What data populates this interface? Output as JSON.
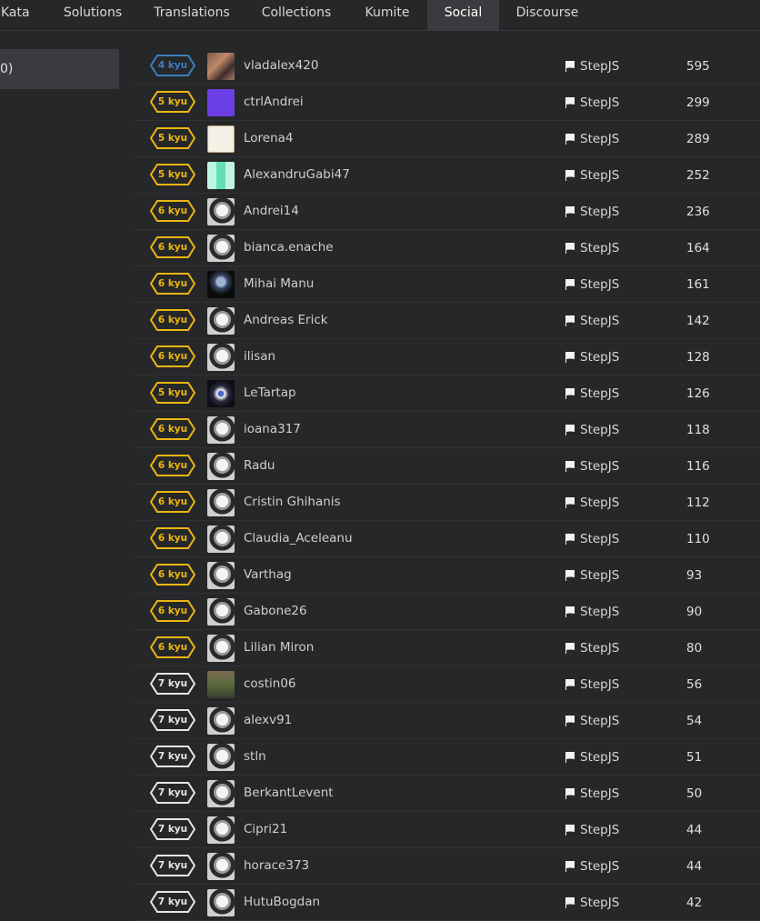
{
  "tabs": [
    {
      "label": "Kata"
    },
    {
      "label": "Solutions"
    },
    {
      "label": "Translations"
    },
    {
      "label": "Collections"
    },
    {
      "label": "Kumite"
    },
    {
      "label": "Social"
    },
    {
      "label": "Discourse"
    }
  ],
  "sidebar": {
    "item_label": "0)"
  },
  "colors": {
    "kyu4": "#3c7ebb",
    "kyu5": "#ecb613",
    "kyu6": "#ecb613",
    "kyu7": "#e6e6e6"
  },
  "members": [
    {
      "rank": "4 kyu",
      "username": "vladalex420",
      "clan": "StepJS",
      "honor": "595"
    },
    {
      "rank": "5 kyu",
      "username": "ctrlAndrei",
      "clan": "StepJS",
      "honor": "299"
    },
    {
      "rank": "5 kyu",
      "username": "Lorena4",
      "clan": "StepJS",
      "honor": "289"
    },
    {
      "rank": "5 kyu",
      "username": "AlexandruGabi47",
      "clan": "StepJS",
      "honor": "252"
    },
    {
      "rank": "6 kyu",
      "username": "Andrei14",
      "clan": "StepJS",
      "honor": "236"
    },
    {
      "rank": "6 kyu",
      "username": "bianca.enache",
      "clan": "StepJS",
      "honor": "164"
    },
    {
      "rank": "6 kyu",
      "username": "Mihai Manu",
      "clan": "StepJS",
      "honor": "161"
    },
    {
      "rank": "6 kyu",
      "username": "Andreas Erick",
      "clan": "StepJS",
      "honor": "142"
    },
    {
      "rank": "6 kyu",
      "username": "ilisan",
      "clan": "StepJS",
      "honor": "128"
    },
    {
      "rank": "5 kyu",
      "username": "LeTartap",
      "clan": "StepJS",
      "honor": "126"
    },
    {
      "rank": "6 kyu",
      "username": "ioana317",
      "clan": "StepJS",
      "honor": "118"
    },
    {
      "rank": "6 kyu",
      "username": "Radu",
      "clan": "StepJS",
      "honor": "116"
    },
    {
      "rank": "6 kyu",
      "username": "Cristin Ghihanis",
      "clan": "StepJS",
      "honor": "112"
    },
    {
      "rank": "6 kyu",
      "username": "Claudia_Aceleanu",
      "clan": "StepJS",
      "honor": "110"
    },
    {
      "rank": "6 kyu",
      "username": "Varthag",
      "clan": "StepJS",
      "honor": "93"
    },
    {
      "rank": "6 kyu",
      "username": "Gabone26",
      "clan": "StepJS",
      "honor": "90"
    },
    {
      "rank": "6 kyu",
      "username": "Lilian Miron",
      "clan": "StepJS",
      "honor": "80"
    },
    {
      "rank": "7 kyu",
      "username": "costin06",
      "clan": "StepJS",
      "honor": "56"
    },
    {
      "rank": "7 kyu",
      "username": "alexv91",
      "clan": "StepJS",
      "honor": "54"
    },
    {
      "rank": "7 kyu",
      "username": "stln",
      "clan": "StepJS",
      "honor": "51"
    },
    {
      "rank": "7 kyu",
      "username": "BerkantLevent",
      "clan": "StepJS",
      "honor": "50"
    },
    {
      "rank": "7 kyu",
      "username": "Cipri21",
      "clan": "StepJS",
      "honor": "44"
    },
    {
      "rank": "7 kyu",
      "username": "horace373",
      "clan": "StepJS",
      "honor": "44"
    },
    {
      "rank": "7 kyu",
      "username": "HutuBogdan",
      "clan": "StepJS",
      "honor": "42"
    }
  ]
}
